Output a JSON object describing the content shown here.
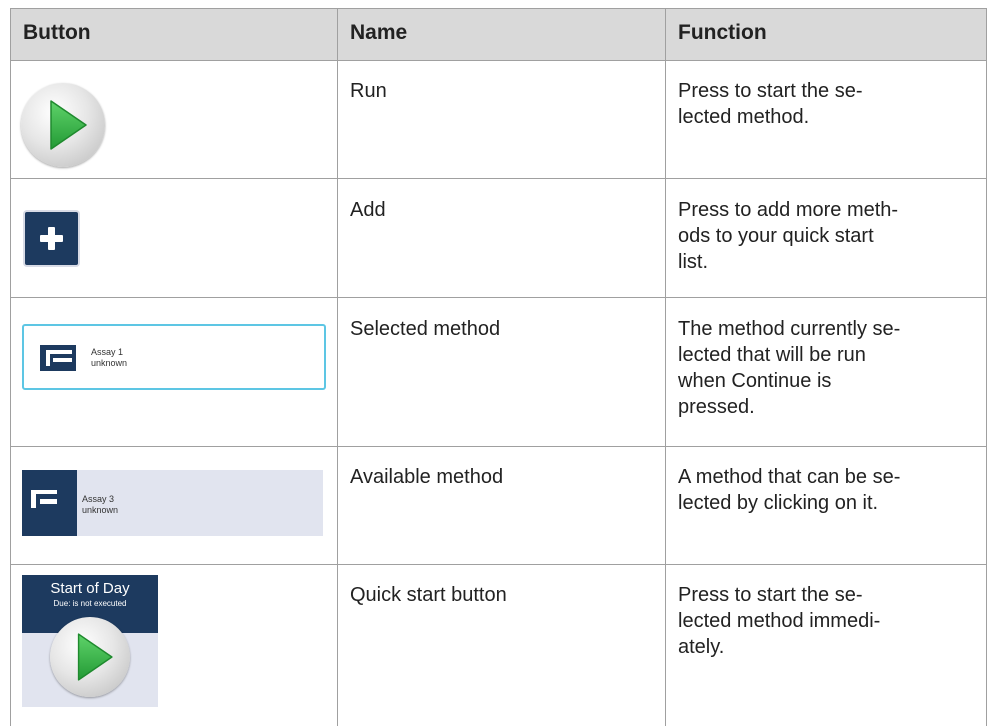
{
  "table": {
    "headers": {
      "button": "Button",
      "name": "Name",
      "function": "Function"
    },
    "rows": [
      {
        "icon": "run-button-icon",
        "name": "Run",
        "function": "Press to start the se-\nlected method."
      },
      {
        "icon": "add-button-icon",
        "name": "Add",
        "function": "Press to add more meth-\nods to your quick start\nlist."
      },
      {
        "icon": "selected-method-card",
        "name": "Selected method",
        "function": "The method currently se-\nlected that will be run\nwhen Continue is\npressed.",
        "card": {
          "title": "Assay 1",
          "subtitle": "unknown"
        }
      },
      {
        "icon": "available-method-card",
        "name": "Available method",
        "function": "A method that can be se-\nlected by clicking on it.",
        "card": {
          "title": "Assay 3",
          "subtitle": "unknown"
        }
      },
      {
        "icon": "quick-start-tile",
        "name": "Quick start button",
        "function": "Press to start the se-\nlected method immedi-\nately.",
        "tile": {
          "title": "Start of Day",
          "subtitle": "Due: is not executed"
        }
      }
    ]
  },
  "colors": {
    "header_bg": "#d9d9d9",
    "grid": "#a0a0a0",
    "navy": "#1d3a5f",
    "card_bg": "#e1e4ef",
    "selected_border": "#5dc6e4",
    "play_green": "#3cb44a"
  }
}
